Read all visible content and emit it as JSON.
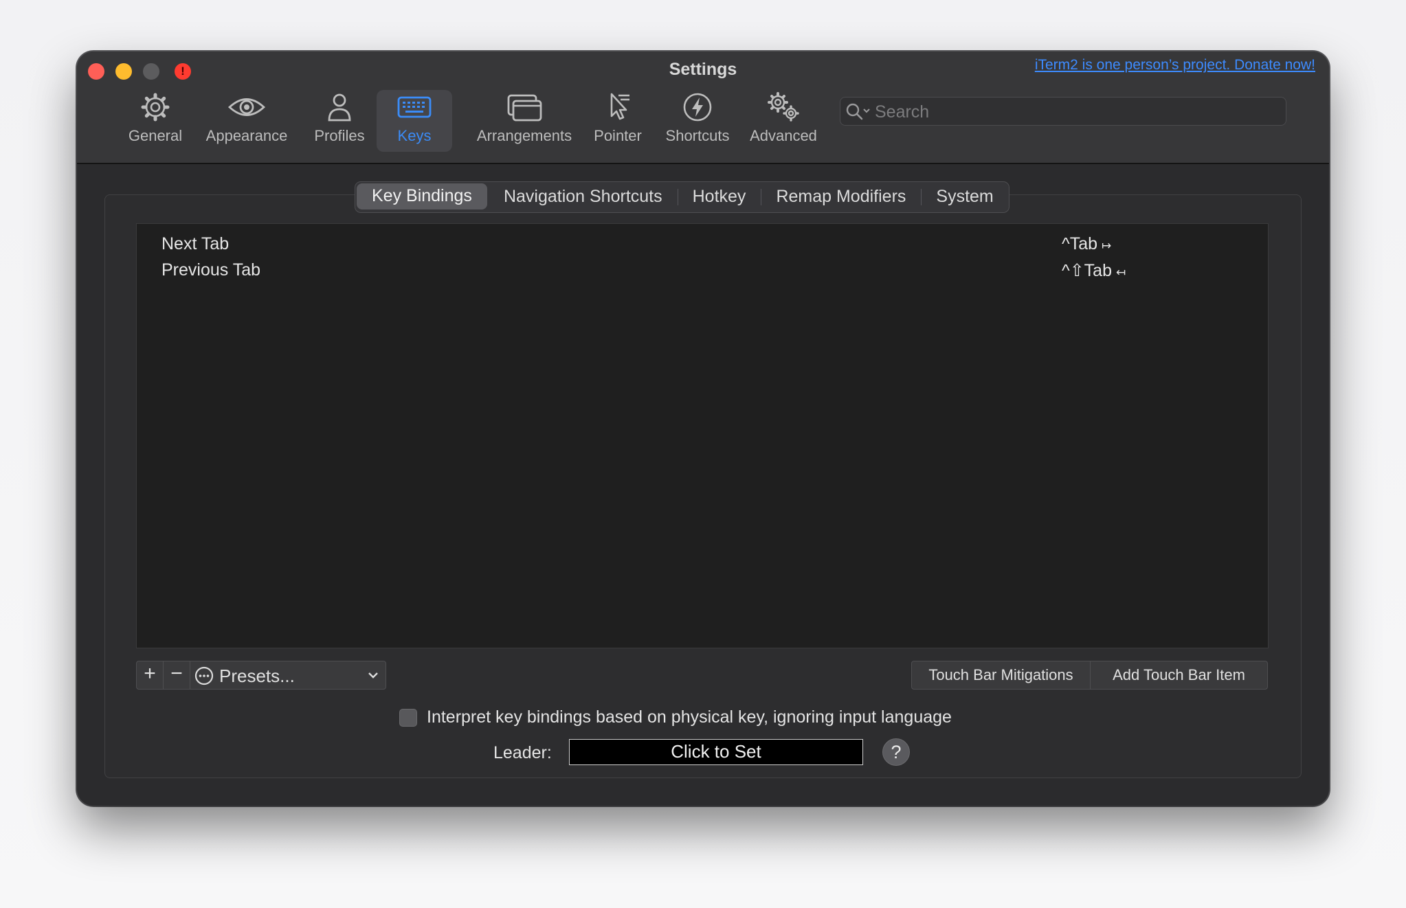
{
  "window": {
    "title": "Settings",
    "donate_link": "iTerm2 is one person’s project. Donate now!",
    "alert_glyph": "!"
  },
  "toolbar": {
    "items": [
      {
        "label": "General",
        "icon": "gear-icon"
      },
      {
        "label": "Appearance",
        "icon": "eye-icon"
      },
      {
        "label": "Profiles",
        "icon": "person-icon"
      },
      {
        "label": "Keys",
        "icon": "keyboard-icon",
        "selected": true
      },
      {
        "label": "Arrangements",
        "icon": "windows-icon"
      },
      {
        "label": "Pointer",
        "icon": "pointer-icon"
      },
      {
        "label": "Shortcuts",
        "icon": "bolt-icon"
      },
      {
        "label": "Advanced",
        "icon": "gears-icon"
      }
    ],
    "search_placeholder": "Search"
  },
  "tabs": [
    {
      "label": "Key Bindings",
      "selected": true
    },
    {
      "label": "Navigation Shortcuts"
    },
    {
      "label": "Hotkey"
    },
    {
      "label": "Remap Modifiers"
    },
    {
      "label": "System"
    }
  ],
  "bindings": [
    {
      "action": "Next Tab",
      "keys": "^Tab",
      "arrow": "↦"
    },
    {
      "action": "Previous Tab",
      "keys": "^⇧Tab",
      "arrow": "↤"
    }
  ],
  "controls": {
    "add_glyph": "+",
    "remove_glyph": "−",
    "presets_label": "Presets...",
    "touch_bar_mitigations": "Touch Bar Mitigations",
    "add_touch_bar_item": "Add Touch Bar Item",
    "physical_key_label": "Interpret key bindings based on physical key, ignoring input language",
    "physical_key_checked": false,
    "leader_label": "Leader:",
    "leader_value": "Click to Set",
    "help_glyph": "?"
  },
  "colors": {
    "accent": "#3b8cf8",
    "link": "#3d8bff",
    "close": "#ff5f57",
    "minimize": "#febc2e",
    "alert": "#ff3b30"
  }
}
